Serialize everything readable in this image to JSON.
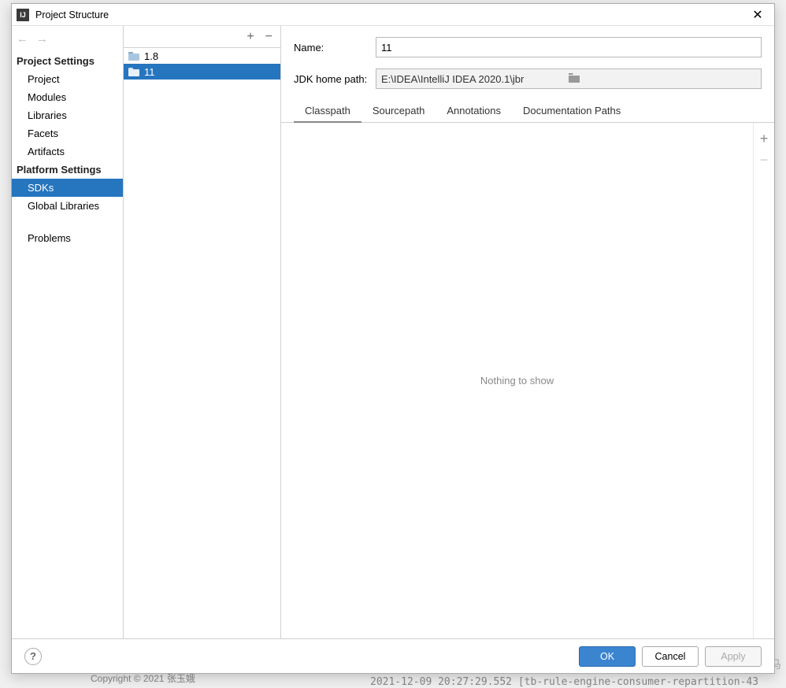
{
  "titlebar": {
    "title": "Project Structure"
  },
  "sidebar": {
    "sections": [
      {
        "header": "Project Settings",
        "items": [
          {
            "label": "Project",
            "selected": false
          },
          {
            "label": "Modules",
            "selected": false
          },
          {
            "label": "Libraries",
            "selected": false
          },
          {
            "label": "Facets",
            "selected": false
          },
          {
            "label": "Artifacts",
            "selected": false
          }
        ]
      },
      {
        "header": "Platform Settings",
        "items": [
          {
            "label": "SDKs",
            "selected": true
          },
          {
            "label": "Global Libraries",
            "selected": false
          }
        ]
      },
      {
        "header": "",
        "items": [
          {
            "label": "Problems",
            "selected": false
          }
        ]
      }
    ]
  },
  "sdk_list": [
    {
      "label": "1.8",
      "selected": false
    },
    {
      "label": "11",
      "selected": true
    }
  ],
  "detail": {
    "name_label": "Name:",
    "name_value": "11",
    "path_label": "JDK home path:",
    "path_value": "E:\\IDEA\\IntelliJ IDEA 2020.1\\jbr",
    "tabs": [
      {
        "label": "Classpath",
        "active": true
      },
      {
        "label": "Sourcepath",
        "active": false
      },
      {
        "label": "Annotations",
        "active": false
      },
      {
        "label": "Documentation Paths",
        "active": false
      }
    ],
    "empty_text": "Nothing to show"
  },
  "footer": {
    "ok": "OK",
    "cancel": "Cancel",
    "apply": "Apply"
  },
  "background": {
    "copyright": "Copyright © 2021 张玉娥",
    "bottom_log": "2021-12-09 20:27:29.552 [tb-rule-engine-consumer-repartition-43",
    "watermark": "CSDN @海伦的特洛伊木马"
  }
}
